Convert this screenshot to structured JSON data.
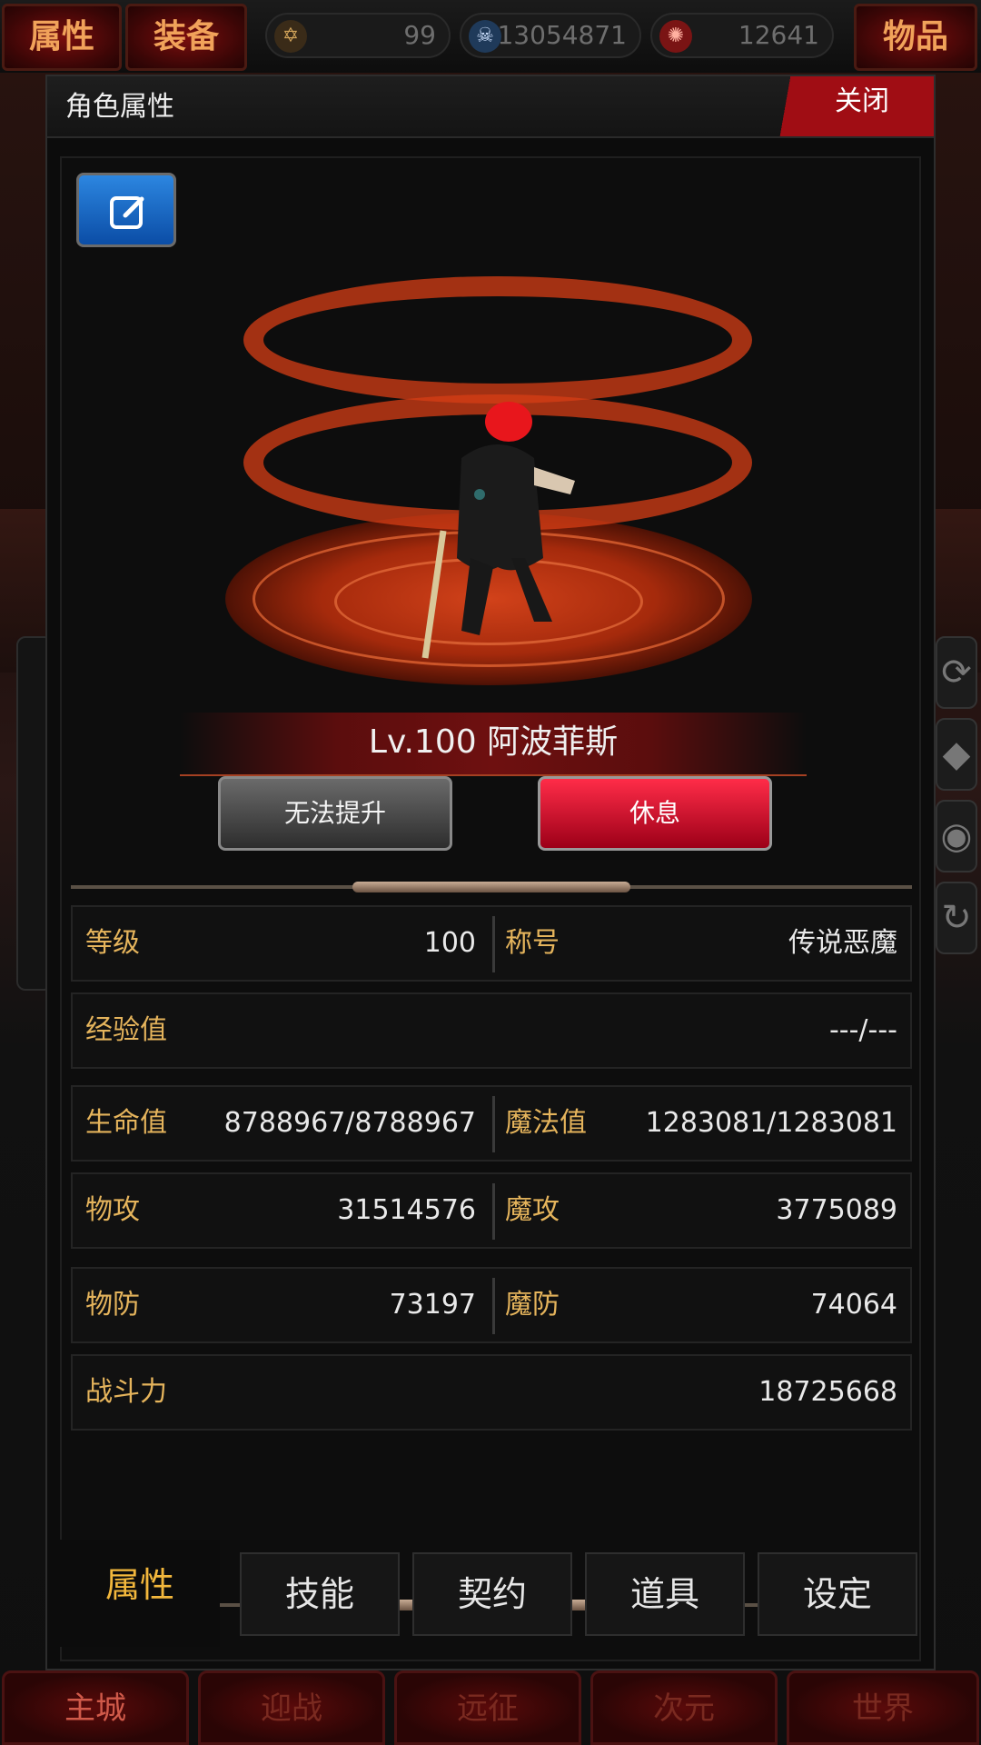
{
  "topbar": {
    "attr_tab": "属性",
    "equip_tab": "装备",
    "items_tab": "物品",
    "resources": [
      {
        "icon": "star-emblem-icon",
        "value": "99"
      },
      {
        "icon": "skull-coin-icon",
        "value": "13054871"
      },
      {
        "icon": "red-gem-icon",
        "value": "12641"
      }
    ]
  },
  "dialog": {
    "title": "角色属性",
    "close_label": "关闭",
    "character_name": "Lv.100 阿波菲斯",
    "upgrade_label": "无法提升",
    "rest_label": "休息",
    "stats": {
      "level": {
        "label": "等级",
        "value": "100"
      },
      "title": {
        "label": "称号",
        "value": "传说恶魔"
      },
      "exp": {
        "label": "经验值",
        "value": "---/---"
      },
      "hp": {
        "label": "生命值",
        "value": "8788967/8788967"
      },
      "mp": {
        "label": "魔法值",
        "value": "1283081/1283081"
      },
      "patk": {
        "label": "物攻",
        "value": "31514576"
      },
      "matk": {
        "label": "魔攻",
        "value": "3775089"
      },
      "pdef": {
        "label": "物防",
        "value": "73197"
      },
      "mdef": {
        "label": "魔防",
        "value": "74064"
      },
      "power": {
        "label": "战斗力",
        "value": "18725668"
      }
    },
    "tabs": [
      "属性",
      "技能",
      "契约",
      "道具",
      "设定"
    ]
  },
  "bottom_nav": [
    "主城",
    "迎战",
    "远征",
    "次元",
    "世界"
  ],
  "colors": {
    "accent_gold": "#e5b45c",
    "close_red": "#a00d14",
    "rest_red": "#ff2c48"
  }
}
